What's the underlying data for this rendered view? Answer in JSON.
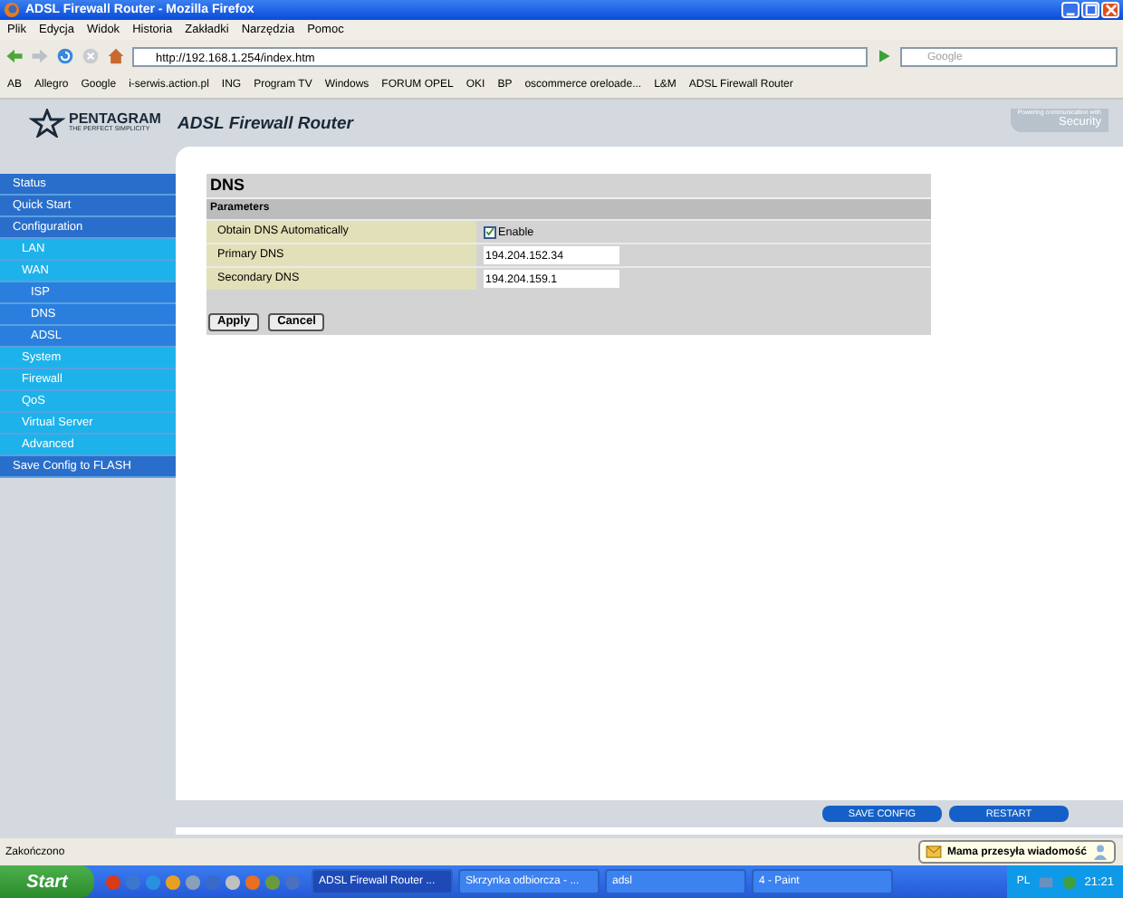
{
  "window": {
    "title": "ADSL Firewall Router - Mozilla Firefox"
  },
  "menu": [
    "Plik",
    "Edycja",
    "Widok",
    "Historia",
    "Zakładki",
    "Narzędzia",
    "Pomoc"
  ],
  "address": "http://192.168.1.254/index.htm",
  "search": {
    "placeholder": "Google"
  },
  "bookmarks": [
    "AB",
    "Allegro",
    "Google",
    "i-serwis.action.pl",
    "ING",
    "Program TV",
    "Windows",
    "FORUM OPEL",
    "OKI",
    "BP",
    "oscommerce oreloade...",
    "L&M",
    "ADSL Firewall Router"
  ],
  "header": {
    "brand": "PENTAGRAM",
    "slogan": "THE PERFECT SIMPLICITY",
    "title": "ADSL Firewall Router",
    "tag_small": "Powering communication with",
    "tag_big": "Security"
  },
  "sidebar": {
    "items": [
      {
        "label": "Status"
      },
      {
        "label": "Quick Start"
      },
      {
        "label": "Configuration",
        "children": [
          {
            "label": "LAN"
          },
          {
            "label": "WAN",
            "children": [
              {
                "label": "ISP"
              },
              {
                "label": "DNS"
              },
              {
                "label": "ADSL"
              }
            ]
          },
          {
            "label": "System"
          },
          {
            "label": "Firewall"
          },
          {
            "label": "QoS"
          },
          {
            "label": "Virtual Server"
          },
          {
            "label": "Advanced"
          }
        ]
      },
      {
        "label": "Save Config to FLASH"
      }
    ]
  },
  "panel": {
    "title": "DNS",
    "section": "Parameters",
    "rows": [
      {
        "kind": "checkbox",
        "label": "Obtain DNS Automatically",
        "checked": true,
        "option": "Enable"
      },
      {
        "kind": "text",
        "label": "Primary DNS",
        "value": "194.204.152.34"
      },
      {
        "kind": "text",
        "label": "Secondary DNS",
        "value": "194.204.159.1"
      }
    ],
    "buttons": [
      "Apply",
      "Cancel"
    ]
  },
  "footer_buttons": [
    "SAVE CONFIG",
    "RESTART"
  ],
  "status_bar": "Zakończono",
  "notification": "Mama przesyła wiadomość",
  "taskbar": {
    "start": "Start",
    "tasks": [
      {
        "label": "ADSL Firewall Router ...",
        "selected": true
      },
      {
        "label": "Skrzynka odbiorcza - ...",
        "selected": false
      },
      {
        "label": "adsl",
        "selected": false
      },
      {
        "label": "4 - Paint",
        "selected": false
      }
    ],
    "language": "PL",
    "clock": "21:21"
  }
}
